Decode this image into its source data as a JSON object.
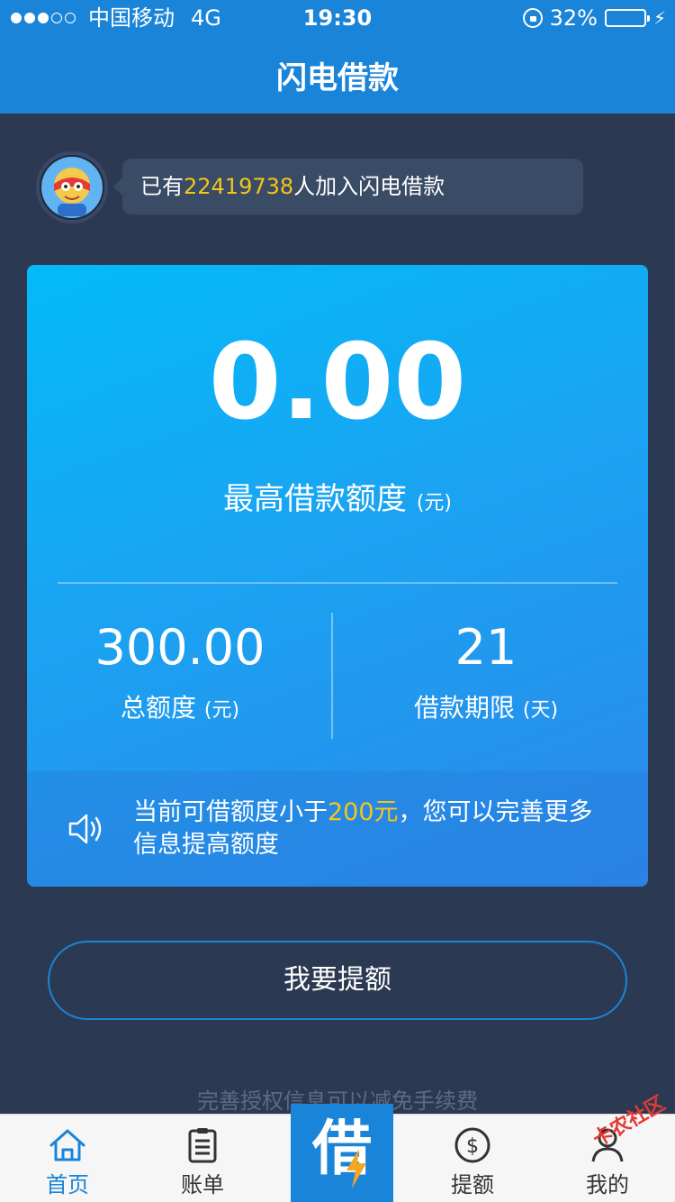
{
  "status_bar": {
    "carrier": "中国移动",
    "network": "4G",
    "time": "19:30",
    "battery_text": "32%",
    "battery_level": 0.32,
    "battery_color": "#4cd964"
  },
  "nav": {
    "title": "闪电借款"
  },
  "banner": {
    "prefix": "已有",
    "count": "22419738",
    "suffix": "人加入闪电借款"
  },
  "card": {
    "max_amount": "0.00",
    "max_label": "最高借款额度",
    "max_unit": "(元)",
    "total_value": "300.00",
    "total_label": "总额度",
    "total_unit": "(元)",
    "term_value": "21",
    "term_label": "借款期限",
    "term_unit": "(天)",
    "notice_prefix": "当前可借额度小于",
    "notice_highlight": "200元",
    "notice_suffix": "，您可以完善更多信息提高额度",
    "icon": "speaker-icon"
  },
  "actions": {
    "raise_button": "我要提额"
  },
  "hint_text": "完善授权信息可以减免手续费",
  "tabs": {
    "home": {
      "label": "首页",
      "icon": "home-icon"
    },
    "bills": {
      "label": "账单",
      "icon": "clipboard-icon"
    },
    "borrow": {
      "label": "借",
      "icon": "lightning-icon"
    },
    "raise": {
      "label": "提额",
      "icon": "dollar-icon"
    },
    "mine": {
      "label": "我的",
      "icon": "person-icon"
    }
  },
  "watermark": "卡农社区",
  "colors": {
    "accent": "#1a84d8",
    "highlight": "#f5c518",
    "background": "#2b3a52"
  }
}
